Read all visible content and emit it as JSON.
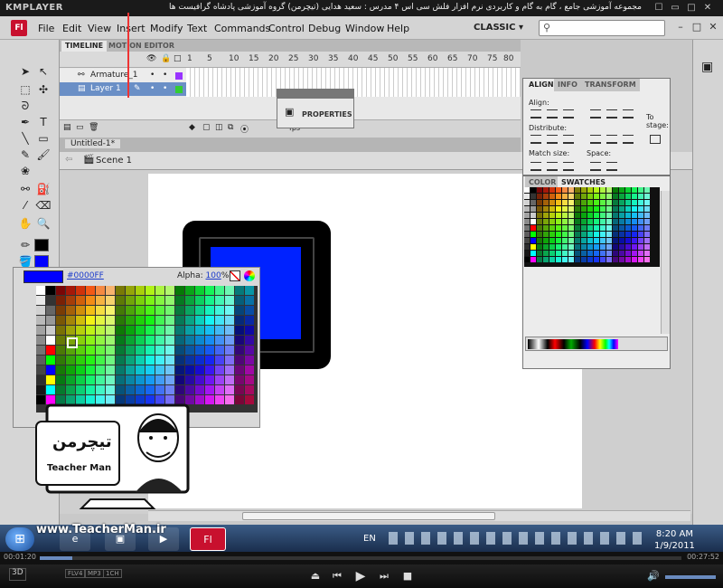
{
  "player": {
    "logo": "KMPLAYER",
    "caption": "مجموعه آموزشی جامع ، گام به گام و کاربردی نرم افزار فلش سی اس ۴ مدرس : سعید هدایی (تیچرمن) گروه آموزشی پادشاه گرافیست ها",
    "controls": [
      "☐",
      "▭",
      "□",
      "✕"
    ],
    "time_elapsed": "00:01:20",
    "time_total": "00:27:52",
    "progress": 0.05,
    "badges": [
      "3D",
      "FLV4",
      "MP3",
      "1CH"
    ]
  },
  "app": {
    "logo": "Fl",
    "menu": [
      "File",
      "Edit",
      "View",
      "Insert",
      "Modify",
      "Text",
      "Commands",
      "Control",
      "Debug",
      "Window",
      "Help"
    ],
    "workspace": "CLASSIC ▾",
    "search_placeholder": "",
    "window_controls": [
      "–",
      "□",
      "✕"
    ]
  },
  "timeline": {
    "tabs": [
      "TIMELINE",
      "MOTION EDITOR"
    ],
    "frame_numbers": [
      "1",
      "5",
      "10",
      "15",
      "20",
      "25",
      "30",
      "35",
      "40",
      "45",
      "50",
      "55",
      "60",
      "65",
      "70",
      "75",
      "80",
      "85"
    ],
    "layers": [
      {
        "name": "Armature_1",
        "color": "#9933ff",
        "selected": false
      },
      {
        "name": "Layer 1",
        "color": "#33cc33",
        "selected": true
      }
    ],
    "fps": "fps"
  },
  "properties_panel": {
    "label": "PROPERTIES"
  },
  "document": {
    "tab": "Untitled-1*",
    "scene": "Scene 1"
  },
  "swatch_popup": {
    "hex": "#0000FF",
    "alpha_label": "Alpha:",
    "alpha_value": "100",
    "alpha_unit": "%",
    "current_color": "#0000ff"
  },
  "align_panel": {
    "tabs": [
      "ALIGN",
      "INFO",
      "TRANSFORM"
    ],
    "align": "Align:",
    "distribute": "Distribute:",
    "match_size": "Match size:",
    "space": "Space:",
    "to_stage": "To stage:"
  },
  "color_panel": {
    "tabs": [
      "COLOR",
      "SWATCHES"
    ]
  },
  "taskbar": {
    "start": "⊞",
    "apps": [
      "e",
      "▣",
      "▶",
      "Fl"
    ],
    "lang": "EN",
    "time": "8:20 AM",
    "date": "1/9/2011"
  },
  "watermark": {
    "url": "www.TeacherMan.ir",
    "logo_text": "تیچرمن",
    "name": "Teacher Man"
  },
  "colors": {
    "selected_fill": "#0000ff",
    "stage_bg": "#ffffff",
    "flash_red": "#c8102e"
  }
}
